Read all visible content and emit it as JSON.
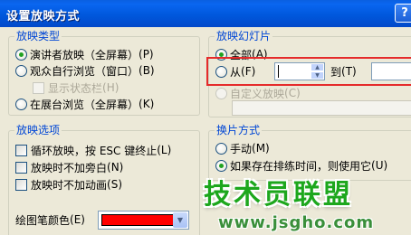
{
  "window": {
    "title": "设置放映方式",
    "help_glyph": "?"
  },
  "show_type": {
    "label": "放映类型",
    "options": [
      {
        "text": "演讲者放映（全屏幕）",
        "key": "(P)",
        "selected": true
      },
      {
        "text": "观众自行浏览（窗口）",
        "key": "(B)",
        "selected": false
      },
      {
        "text": "在展台浏览（全屏幕）",
        "key": "(K)",
        "selected": false
      }
    ],
    "status_bar": {
      "text": "显示状态栏",
      "key": "(H)",
      "checked": false,
      "disabled": true
    }
  },
  "show_options": {
    "label": "放映选项",
    "items": [
      {
        "text": "循环放映，按 ESC 键终止",
        "key": "(L)",
        "checked": false
      },
      {
        "text": "放映时不加旁白",
        "key": "(N)",
        "checked": false
      },
      {
        "text": "放映时不加动画",
        "key": "(S)",
        "checked": false
      }
    ],
    "pen_color": {
      "label": "绘图笔颜色",
      "key": "(E)",
      "value_color": "#FF0000"
    }
  },
  "show_slides": {
    "label": "放映幻灯片",
    "all": {
      "text": "全部",
      "key": "(A)",
      "selected": true
    },
    "from": {
      "text": "从",
      "key": "(F)",
      "value": ""
    },
    "to": {
      "text": "到",
      "key": "(T)",
      "value": ""
    },
    "custom": {
      "text": "自定义放映",
      "key": "(C)",
      "disabled": true
    }
  },
  "advance": {
    "label": "换片方式",
    "manual": {
      "text": "手动",
      "key": "(M)",
      "selected": false
    },
    "timings": {
      "text": "如果存在排练时间，则使用它",
      "key": "(U)",
      "selected": true
    }
  },
  "watermark": {
    "title": "技术员联盟",
    "url": "www.jsgho.com"
  },
  "colors": {
    "accent": "#0046D5",
    "highlight_box": "#E52B2B",
    "titlebar": "#0058DD"
  }
}
